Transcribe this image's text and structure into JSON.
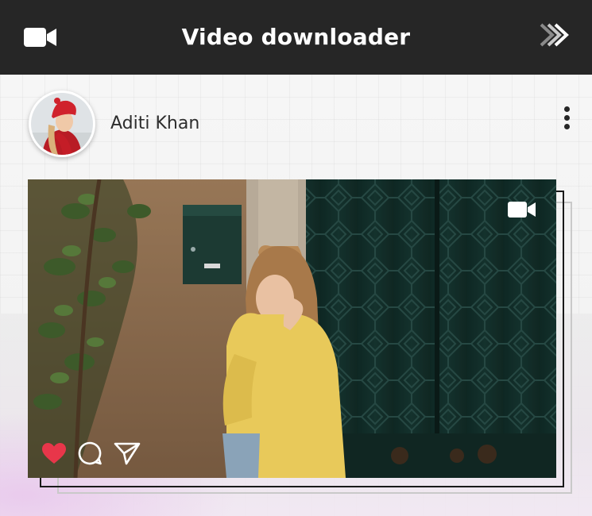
{
  "header": {
    "title": "Video downloader",
    "left_icon": "video-camera-icon",
    "right_icon": "double-chevron-right-icon"
  },
  "post": {
    "username": "Aditi Khan",
    "menu_icon": "vertical-ellipsis-icon",
    "media_badge_icon": "video-camera-icon",
    "actions": [
      {
        "icon": "heart-icon",
        "state": "liked",
        "color": "#e8364a"
      },
      {
        "icon": "comment-icon"
      },
      {
        "icon": "share-icon"
      }
    ]
  },
  "colors": {
    "topbar": "#262626",
    "like": "#e8364a",
    "text": "#2d2d2d"
  }
}
